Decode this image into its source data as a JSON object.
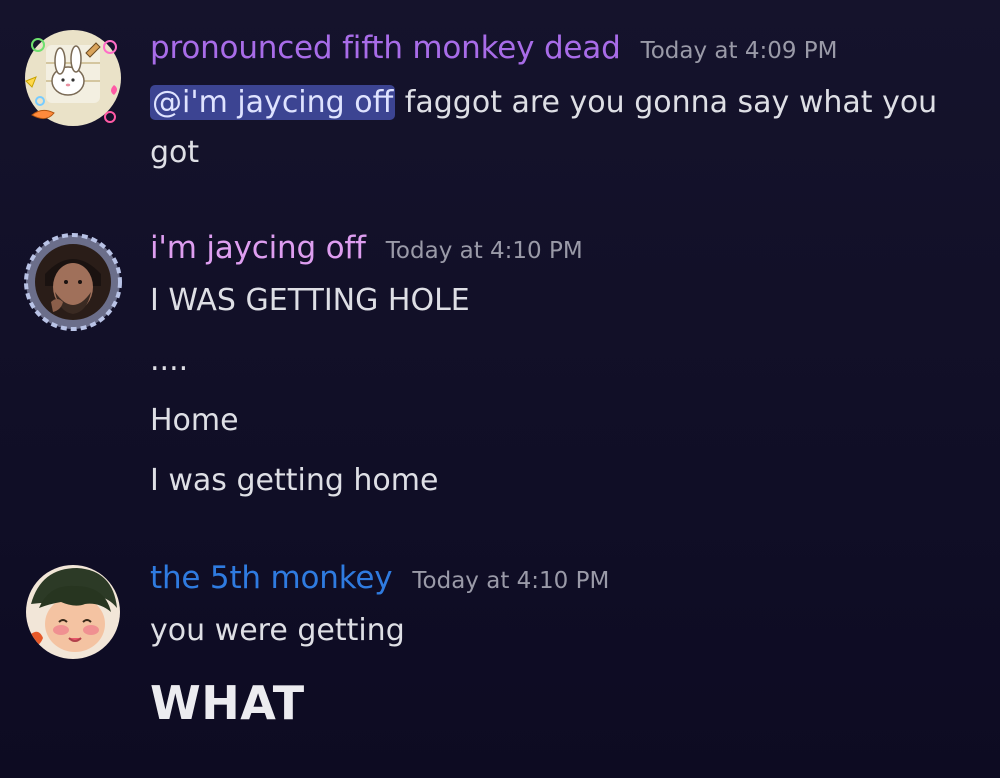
{
  "messages": [
    {
      "username": "pronounced fifth monkey dead",
      "username_color": "#a86ce8",
      "timestamp": "Today at 4:09 PM",
      "avatar_icon": "bunny-with-stickers-avatar",
      "mention": "@i'm jaycing off",
      "text_after_mention": " faggot are you gonna say what you got"
    },
    {
      "username": "i'm jaycing off",
      "username_color": "#de9ef0",
      "timestamp": "Today at 4:10 PM",
      "avatar_icon": "bearded-man-avatar",
      "lines": [
        "I WAS GETTING HOLE",
        "....",
        "Home",
        "I was getting home"
      ]
    },
    {
      "username": "the 5th monkey",
      "username_color": "#2f7be0",
      "timestamp": "Today at 4:10 PM",
      "avatar_icon": "blushing-boy-avatar",
      "lines": [
        "you were getting"
      ],
      "heading": "WHAT"
    }
  ]
}
